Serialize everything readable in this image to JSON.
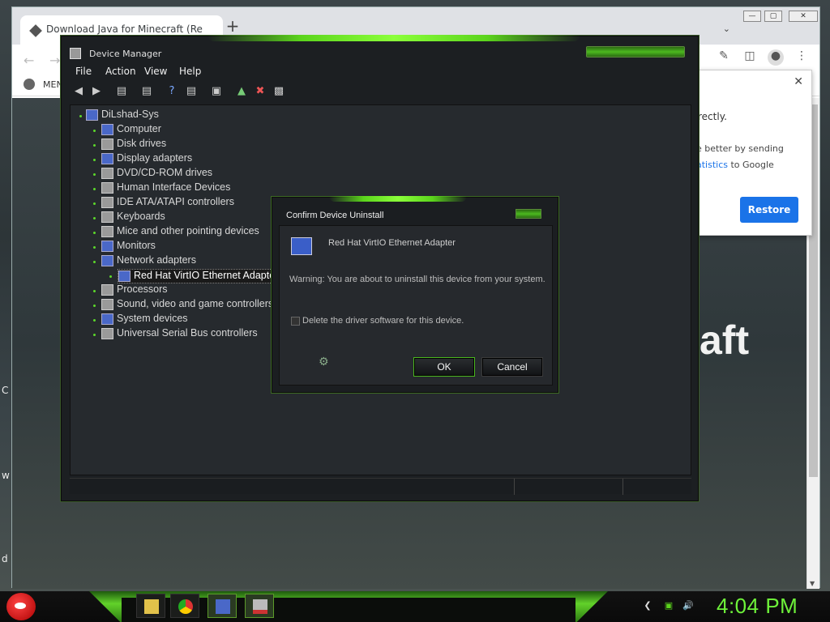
{
  "chrome": {
    "tab_title": "Download Java for Minecraft (Re",
    "new_tab": "+",
    "bookmark_label": "MEN",
    "page_text": "aft",
    "popup": {
      "line1": "rectly.",
      "line2": "e better by sending",
      "line3_link": "atistics",
      "line3_rest": " to Google",
      "restore_label": "Restore",
      "close": "✕"
    }
  },
  "edge_letters": [
    "C",
    "w",
    "d"
  ],
  "device_manager": {
    "title": "Device Manager",
    "menu": [
      "File",
      "Action",
      "View",
      "Help"
    ],
    "root": "DiLshad-Sys",
    "tree": [
      {
        "label": "Computer",
        "icon": "computer-icon"
      },
      {
        "label": "Disk drives",
        "icon": "disk-drive-icon"
      },
      {
        "label": "Display adapters",
        "icon": "display-adapter-icon"
      },
      {
        "label": "DVD/CD-ROM drives",
        "icon": "dvd-drive-icon"
      },
      {
        "label": "Human Interface Devices",
        "icon": "hid-icon"
      },
      {
        "label": "IDE ATA/ATAPI controllers",
        "icon": "ide-controller-icon"
      },
      {
        "label": "Keyboards",
        "icon": "keyboard-icon"
      },
      {
        "label": "Mice and other pointing devices",
        "icon": "mouse-icon"
      },
      {
        "label": "Monitors",
        "icon": "monitor-icon"
      },
      {
        "label": "Network adapters",
        "icon": "network-adapter-icon"
      },
      {
        "label": "Red Hat VirtIO Ethernet Adapter",
        "icon": "ethernet-adapter-icon",
        "child": true,
        "selected": true
      },
      {
        "label": "Processors",
        "icon": "processor-icon"
      },
      {
        "label": "Sound, video and game controllers",
        "icon": "sound-icon"
      },
      {
        "label": "System devices",
        "icon": "system-devices-icon"
      },
      {
        "label": "Universal Serial Bus controllers",
        "icon": "usb-icon"
      }
    ]
  },
  "dialog": {
    "title": "Confirm Device Uninstall",
    "device_name": "Red Hat VirtIO Ethernet Adapter",
    "warning": "Warning: You are about to uninstall this device from your system.",
    "checkbox_label": "Delete the driver software for this device.",
    "checkbox_checked": false,
    "ok_label": "OK",
    "cancel_label": "Cancel"
  },
  "taskbar": {
    "clock": "4:04 PM",
    "apps": [
      "file-explorer",
      "chrome",
      "device-manager",
      "uninstall-dialog"
    ]
  },
  "colors": {
    "accent_green": "#5bd41c",
    "clock_green": "#6ef23a",
    "restore_blue": "#1a73e8"
  }
}
